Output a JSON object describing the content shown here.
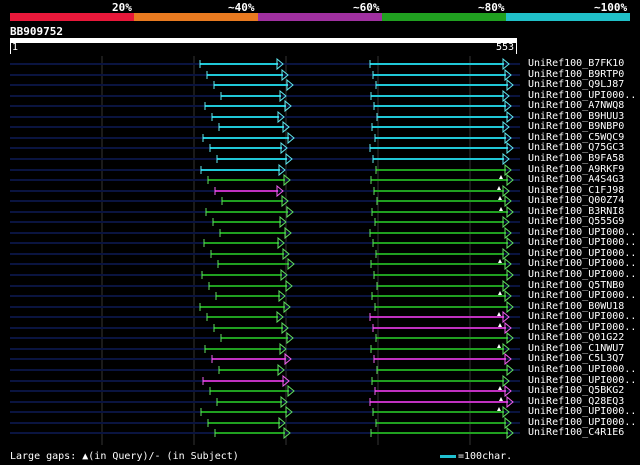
{
  "legend": {
    "segments": [
      {
        "color": "#e8183a"
      },
      {
        "color": "#e87a20"
      },
      {
        "color": "#a030a0"
      },
      {
        "color": "#20a020"
      },
      {
        "color": "#20c0c8"
      }
    ],
    "labels": [
      "20%",
      "~40%",
      "~60%",
      "~80%",
      "~100%"
    ]
  },
  "query": {
    "title": "BB909752",
    "start": "1",
    "end": "553"
  },
  "colors": {
    "cyan": "#20c8d8",
    "green": "#20a020",
    "purple": "#c030c0",
    "navy": "#0a1440",
    "arrow_green": "#60e060",
    "arrow_cyan": "#60e8f0",
    "arrow_purple": "#f060f0"
  },
  "hits": [
    {
      "name": "UniRef100_B7FK10",
      "tier": "cyan",
      "gap": false
    },
    {
      "name": "UniRef100_B9RTP0",
      "tier": "cyan",
      "gap": false
    },
    {
      "name": "UniRef100_Q9LJ87",
      "tier": "cyan",
      "gap": false
    },
    {
      "name": "UniRef100_UPI000..",
      "tier": "cyan",
      "gap": false
    },
    {
      "name": "UniRef100_A7NWQ8",
      "tier": "cyan",
      "gap": false
    },
    {
      "name": "UniRef100_B9HUU3",
      "tier": "cyan",
      "gap": false
    },
    {
      "name": "UniRef100_B9NBP0",
      "tier": "cyan",
      "gap": false
    },
    {
      "name": "UniRef100_C5WQC9",
      "tier": "cyan",
      "gap": false
    },
    {
      "name": "UniRef100_Q75GC3",
      "tier": "cyan",
      "gap": false
    },
    {
      "name": "UniRef100_B9FA58",
      "tier": "cyan",
      "gap": false
    },
    {
      "name": "UniRef100_A9RKF9",
      "tier": "mixed1",
      "gap": false
    },
    {
      "name": "UniRef100_A4S4G3",
      "tier": "green",
      "gap": true
    },
    {
      "name": "UniRef100_C1FJ98",
      "tier": "purple1",
      "gap": true
    },
    {
      "name": "UniRef100_Q00Z74",
      "tier": "green",
      "gap": true
    },
    {
      "name": "UniRef100_B3RNI8",
      "tier": "green",
      "gap": true
    },
    {
      "name": "UniRef100_Q555G9",
      "tier": "green",
      "gap": false
    },
    {
      "name": "UniRef100_UPI000..",
      "tier": "green",
      "gap": false
    },
    {
      "name": "UniRef100_UPI000..",
      "tier": "green",
      "gap": false
    },
    {
      "name": "UniRef100_UPI000..",
      "tier": "green",
      "gap": false
    },
    {
      "name": "UniRef100_UPI000..",
      "tier": "green",
      "gap": true
    },
    {
      "name": "UniRef100_UPI000..",
      "tier": "green",
      "gap": false
    },
    {
      "name": "UniRef100_Q5TNB0",
      "tier": "green",
      "gap": false
    },
    {
      "name": "UniRef100_UPI000..",
      "tier": "green",
      "gap": true
    },
    {
      "name": "UniRef100_B0WU18",
      "tier": "green",
      "gap": false
    },
    {
      "name": "UniRef100_UPI000..",
      "tier": "purple2",
      "gap": true
    },
    {
      "name": "UniRef100_UPI000..",
      "tier": "purple2",
      "gap": true
    },
    {
      "name": "UniRef100_Q01G22",
      "tier": "green",
      "gap": false
    },
    {
      "name": "UniRef100_C1NWU7",
      "tier": "green",
      "gap": true
    },
    {
      "name": "UniRef100_C5L3Q7",
      "tier": "purple3",
      "gap": false
    },
    {
      "name": "UniRef100_UPI000..",
      "tier": "mixed2",
      "gap": false
    },
    {
      "name": "UniRef100_UPI000..",
      "tier": "mixed3",
      "gap": false
    },
    {
      "name": "UniRef100_Q5BKG2",
      "tier": "mixed4",
      "gap": true
    },
    {
      "name": "UniRef100_Q28EQ3",
      "tier": "mixed5",
      "gap": true
    },
    {
      "name": "UniRef100_UPI000..",
      "tier": "green",
      "gap": true
    },
    {
      "name": "UniRef100_UPI000..",
      "tier": "green",
      "gap": false
    },
    {
      "name": "UniRef100_C4R1E6",
      "tier": "green",
      "gap": false
    }
  ],
  "footer": {
    "gaps_label": "Large gaps:",
    "gaps_query": "▲(in Query)/",
    "gaps_subject": "- (in Subject)",
    "scale_label": "=100char."
  }
}
